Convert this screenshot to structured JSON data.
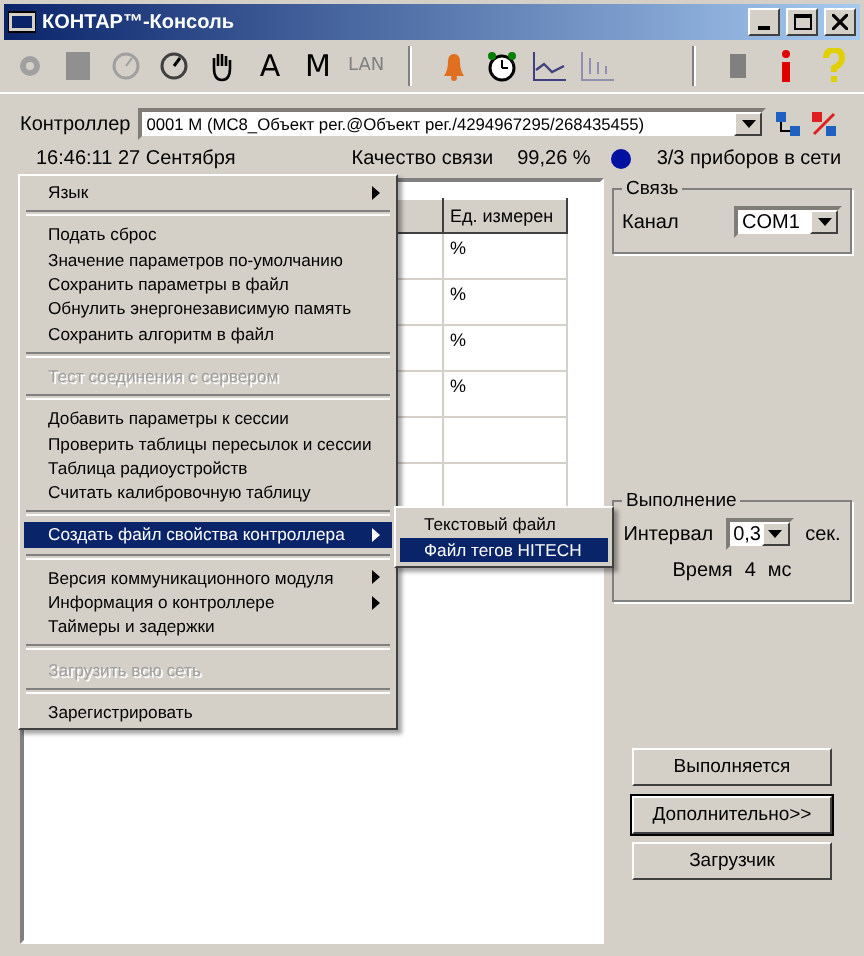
{
  "window": {
    "title": "КОНТАР™-Консоль"
  },
  "toolbar": {
    "text_buttons": [
      {
        "label": "A",
        "disabled": false
      },
      {
        "label": "M",
        "disabled": false
      },
      {
        "label": "LAN",
        "disabled": true
      }
    ]
  },
  "controller": {
    "label": "Контроллер",
    "value": "0001 M (MC8_Объект рег.@Объект рег./4294967295/268435455)"
  },
  "status": {
    "datetime": "16:46:11 27 Сентября",
    "quality_label": "Качество связи",
    "quality_value": "99,26 %",
    "devices": "3/3 приборов в сети"
  },
  "table": {
    "columns": [
      "",
      "Ед. измерен"
    ],
    "rows": [
      [
        "",
        "%"
      ],
      [
        "",
        "%"
      ],
      [
        "",
        "%"
      ],
      [
        "",
        "%"
      ],
      [
        "",
        ""
      ],
      [
        "",
        ""
      ]
    ]
  },
  "menu": [
    {
      "kind": "item",
      "label": "Язык",
      "submenu": true,
      "disabled": false,
      "selected": false
    },
    {
      "kind": "separator"
    },
    {
      "kind": "item",
      "label": "Подать сброс",
      "submenu": false,
      "disabled": false,
      "selected": false
    },
    {
      "kind": "item",
      "label": "Значение параметров по-умолчанию",
      "submenu": false,
      "disabled": false,
      "selected": false
    },
    {
      "kind": "item",
      "label": "Сохранить параметры в файл",
      "submenu": false,
      "disabled": false,
      "selected": false
    },
    {
      "kind": "item",
      "label": "Обнулить энергонезависимую память",
      "submenu": false,
      "disabled": false,
      "selected": false
    },
    {
      "kind": "item",
      "label": "Сохранить алгоритм в файл",
      "submenu": false,
      "disabled": false,
      "selected": false
    },
    {
      "kind": "separator"
    },
    {
      "kind": "item",
      "label": "Тест соединения с сервером",
      "submenu": false,
      "disabled": true,
      "selected": false
    },
    {
      "kind": "separator"
    },
    {
      "kind": "item",
      "label": "Добавить параметры к сессии",
      "submenu": false,
      "disabled": false,
      "selected": false
    },
    {
      "kind": "item",
      "label": "Проверить таблицы пересылок и сессии",
      "submenu": false,
      "disabled": false,
      "selected": false
    },
    {
      "kind": "item",
      "label": "Таблица радиоустройств",
      "submenu": false,
      "disabled": false,
      "selected": false
    },
    {
      "kind": "item",
      "label": "Считать калибровочную таблицу",
      "submenu": false,
      "disabled": false,
      "selected": false
    },
    {
      "kind": "separator"
    },
    {
      "kind": "item",
      "label": "Создать файл свойства контроллера",
      "submenu": true,
      "disabled": false,
      "selected": true
    },
    {
      "kind": "separator"
    },
    {
      "kind": "item",
      "label": "Версия коммуникационного модуля",
      "submenu": true,
      "disabled": false,
      "selected": false
    },
    {
      "kind": "item",
      "label": "Информация о контроллере",
      "submenu": true,
      "disabled": false,
      "selected": false
    },
    {
      "kind": "item",
      "label": "Таймеры и задержки",
      "submenu": false,
      "disabled": false,
      "selected": false
    },
    {
      "kind": "separator"
    },
    {
      "kind": "item",
      "label": "Загрузить всю сеть",
      "submenu": false,
      "disabled": true,
      "selected": false
    },
    {
      "kind": "separator"
    },
    {
      "kind": "item",
      "label": "Зарегистрировать",
      "submenu": false,
      "disabled": false,
      "selected": false
    }
  ],
  "submenu": [
    {
      "label": "Текстовый файл",
      "selected": false
    },
    {
      "label": "Файл тегов HITECH",
      "selected": true
    }
  ],
  "link_group": {
    "title": "Связь",
    "channel_label": "Канал",
    "channel_value": "COM1"
  },
  "exec_group": {
    "title": "Выполнение",
    "interval_label": "Интервал",
    "interval_value": "0,3",
    "interval_unit": "сек.",
    "time_label": "Время",
    "time_value": "4",
    "time_unit": "мс"
  },
  "buttons": [
    {
      "label": "Выполняется",
      "default": false
    },
    {
      "label": "Дополнительно>>",
      "default": true
    },
    {
      "label": "Загрузчик",
      "default": false
    }
  ]
}
